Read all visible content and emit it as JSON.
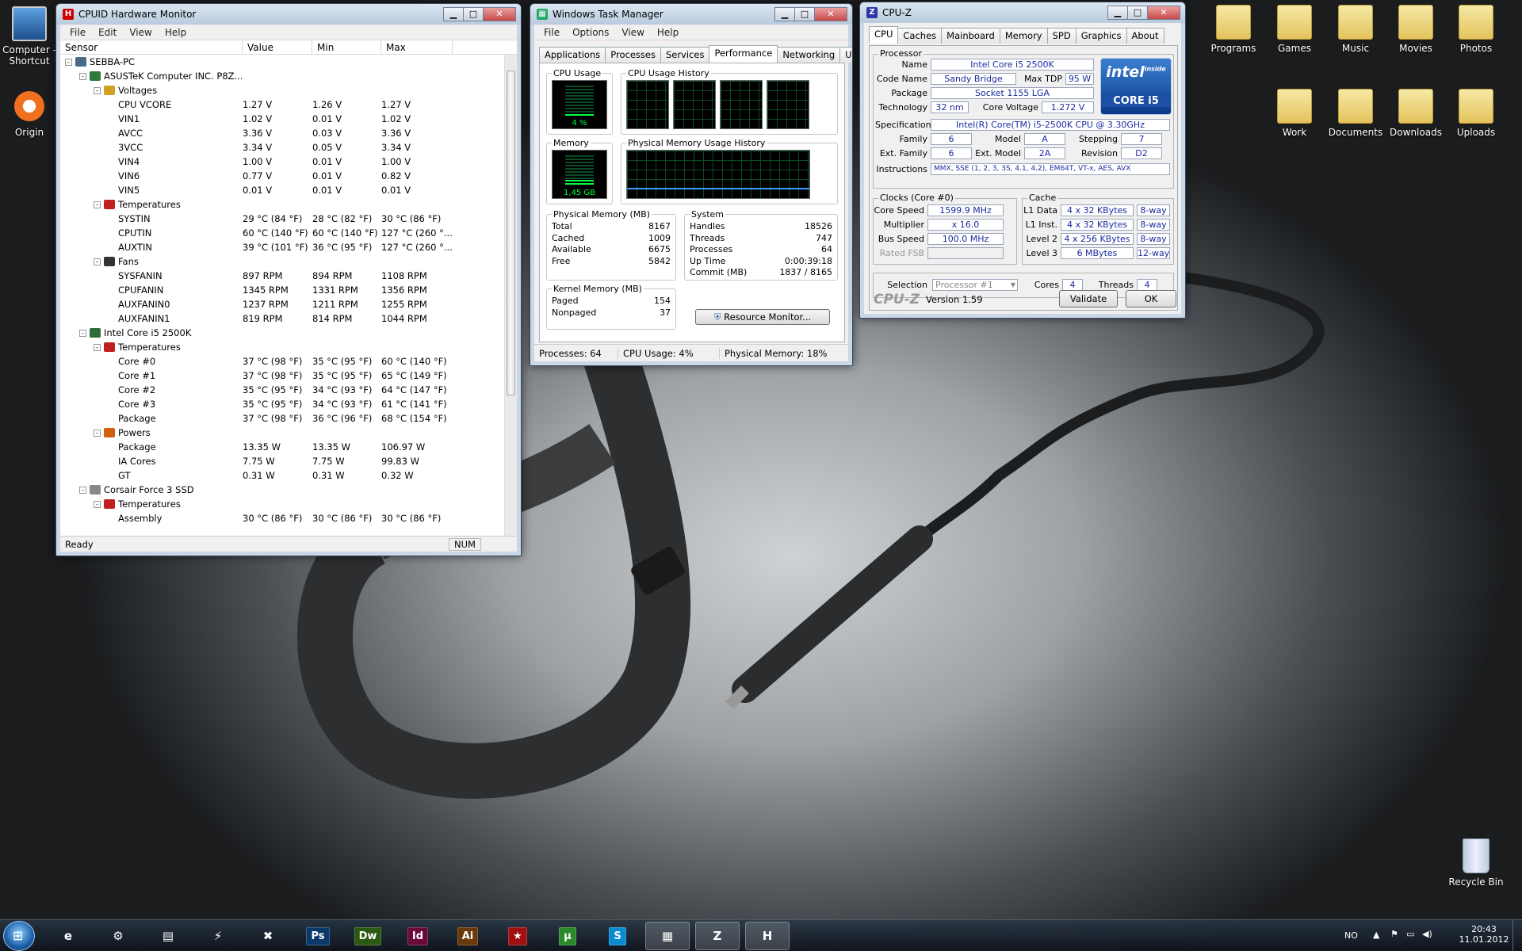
{
  "desktop": {
    "left_icons": [
      {
        "label": "Computer - Shortcut"
      },
      {
        "label": "Origin"
      }
    ],
    "right_icons": [
      {
        "label": "Programs"
      },
      {
        "label": "Games"
      },
      {
        "label": "Music"
      },
      {
        "label": "Movies"
      },
      {
        "label": "Photos"
      },
      {
        "label": "Work"
      },
      {
        "label": "Documents"
      },
      {
        "label": "Downloads"
      },
      {
        "label": "Uploads"
      }
    ],
    "recycle_bin": "Recycle Bin"
  },
  "hwmonitor": {
    "title": "CPUID Hardware Monitor",
    "menu": [
      "File",
      "Edit",
      "View",
      "Help"
    ],
    "columns": [
      "Sensor",
      "Value",
      "Min",
      "Max"
    ],
    "rows": [
      {
        "level": 0,
        "expander": "-",
        "name": "SEBBA-PC",
        "icon": "computer-icon",
        "value": "",
        "min": "",
        "max": ""
      },
      {
        "level": 1,
        "expander": "-",
        "name": "ASUSTeK Computer INC. P8Z...",
        "icon": "motherboard-icon",
        "value": "",
        "min": "",
        "max": ""
      },
      {
        "level": 2,
        "expander": "-",
        "name": "Voltages",
        "icon": "voltage-icon",
        "value": "",
        "min": "",
        "max": ""
      },
      {
        "level": 3,
        "name": "CPU VCORE",
        "value": "1.27 V",
        "min": "1.26 V",
        "max": "1.27 V"
      },
      {
        "level": 3,
        "name": "VIN1",
        "value": "1.02 V",
        "min": "0.01 V",
        "max": "1.02 V"
      },
      {
        "level": 3,
        "name": "AVCC",
        "value": "3.36 V",
        "min": "0.03 V",
        "max": "3.36 V"
      },
      {
        "level": 3,
        "name": "3VCC",
        "value": "3.34 V",
        "min": "0.05 V",
        "max": "3.34 V"
      },
      {
        "level": 3,
        "name": "VIN4",
        "value": "1.00 V",
        "min": "0.01 V",
        "max": "1.00 V"
      },
      {
        "level": 3,
        "name": "VIN6",
        "value": "0.77 V",
        "min": "0.01 V",
        "max": "0.82 V"
      },
      {
        "level": 3,
        "name": "VIN5",
        "value": "0.01 V",
        "min": "0.01 V",
        "max": "0.01 V"
      },
      {
        "level": 2,
        "expander": "-",
        "name": "Temperatures",
        "icon": "thermometer-icon",
        "value": "",
        "min": "",
        "max": ""
      },
      {
        "level": 3,
        "name": "SYSTIN",
        "value": "29 °C  (84 °F)",
        "min": "28 °C  (82 °F)",
        "max": "30 °C  (86 °F)"
      },
      {
        "level": 3,
        "name": "CPUTIN",
        "value": "60 °C  (140 °F)",
        "min": "60 °C  (140 °F)",
        "max": "127 °C  (260 °..."
      },
      {
        "level": 3,
        "name": "AUXTIN",
        "value": "39 °C  (101 °F)",
        "min": "36 °C  (95 °F)",
        "max": "127 °C  (260 °..."
      },
      {
        "level": 2,
        "expander": "-",
        "name": "Fans",
        "icon": "fan-icon",
        "value": "",
        "min": "",
        "max": ""
      },
      {
        "level": 3,
        "name": "SYSFANIN",
        "value": "897 RPM",
        "min": "894 RPM",
        "max": "1108 RPM"
      },
      {
        "level": 3,
        "name": "CPUFANIN",
        "value": "1345 RPM",
        "min": "1331 RPM",
        "max": "1356 RPM"
      },
      {
        "level": 3,
        "name": "AUXFANIN0",
        "value": "1237 RPM",
        "min": "1211 RPM",
        "max": "1255 RPM"
      },
      {
        "level": 3,
        "name": "AUXFANIN1",
        "value": "819 RPM",
        "min": "814 RPM",
        "max": "1044 RPM"
      },
      {
        "level": 1,
        "expander": "-",
        "name": "Intel Core i5 2500K",
        "icon": "cpu-icon",
        "value": "",
        "min": "",
        "max": ""
      },
      {
        "level": 2,
        "expander": "-",
        "name": "Temperatures",
        "icon": "thermometer-icon",
        "value": "",
        "min": "",
        "max": ""
      },
      {
        "level": 3,
        "name": "Core #0",
        "value": "37 °C  (98 °F)",
        "min": "35 °C  (95 °F)",
        "max": "60 °C  (140 °F)"
      },
      {
        "level": 3,
        "name": "Core #1",
        "value": "37 °C  (98 °F)",
        "min": "35 °C  (95 °F)",
        "max": "65 °C  (149 °F)"
      },
      {
        "level": 3,
        "name": "Core #2",
        "value": "35 °C  (95 °F)",
        "min": "34 °C  (93 °F)",
        "max": "64 °C  (147 °F)"
      },
      {
        "level": 3,
        "name": "Core #3",
        "value": "35 °C  (95 °F)",
        "min": "34 °C  (93 °F)",
        "max": "61 °C  (141 °F)"
      },
      {
        "level": 3,
        "name": "Package",
        "value": "37 °C  (98 °F)",
        "min": "36 °C  (96 °F)",
        "max": "68 °C  (154 °F)"
      },
      {
        "level": 2,
        "expander": "-",
        "name": "Powers",
        "icon": "power-icon",
        "value": "",
        "min": "",
        "max": ""
      },
      {
        "level": 3,
        "name": "Package",
        "value": "13.35 W",
        "min": "13.35 W",
        "max": "106.97 W"
      },
      {
        "level": 3,
        "name": "IA Cores",
        "value": "7.75 W",
        "min": "7.75 W",
        "max": "99.83 W"
      },
      {
        "level": 3,
        "name": "GT",
        "value": "0.31 W",
        "min": "0.31 W",
        "max": "0.32 W"
      },
      {
        "level": 1,
        "expander": "-",
        "name": "Corsair Force 3 SSD",
        "icon": "drive-icon",
        "value": "",
        "min": "",
        "max": ""
      },
      {
        "level": 2,
        "expander": "-",
        "name": "Temperatures",
        "icon": "thermometer-icon",
        "value": "",
        "min": "",
        "max": ""
      },
      {
        "level": 3,
        "name": "Assembly",
        "value": "30 °C  (86 °F)",
        "min": "30 °C  (86 °F)",
        "max": "30 °C  (86 °F)"
      }
    ],
    "status": {
      "text": "Ready",
      "num": "NUM"
    }
  },
  "taskmgr": {
    "title": "Windows Task Manager",
    "menu": [
      "File",
      "Options",
      "View",
      "Help"
    ],
    "tabs": [
      "Applications",
      "Processes",
      "Services",
      "Performance",
      "Networking",
      "Users"
    ],
    "active_tab": "Performance",
    "cpu_usage_label": "CPU Usage",
    "cpu_usage_value": "4 %",
    "cpu_usage_fraction": 0.04,
    "cpu_history_label": "CPU Usage History",
    "memory_label": "Memory",
    "memory_value": "1,45 GB",
    "memory_fraction": 0.18,
    "memory_history_label": "Physical Memory Usage History",
    "physical_memory": {
      "title": "Physical Memory (MB)",
      "items": [
        {
          "k": "Total",
          "v": "8167"
        },
        {
          "k": "Cached",
          "v": "1009"
        },
        {
          "k": "Available",
          "v": "6675"
        },
        {
          "k": "Free",
          "v": "5842"
        }
      ]
    },
    "kernel_memory": {
      "title": "Kernel Memory (MB)",
      "items": [
        {
          "k": "Paged",
          "v": "154"
        },
        {
          "k": "Nonpaged",
          "v": "37"
        }
      ]
    },
    "system": {
      "title": "System",
      "items": [
        {
          "k": "Handles",
          "v": "18526"
        },
        {
          "k": "Threads",
          "v": "747"
        },
        {
          "k": "Processes",
          "v": "64"
        },
        {
          "k": "Up Time",
          "v": "0:00:39:18"
        },
        {
          "k": "Commit (MB)",
          "v": "1837 / 8165"
        }
      ]
    },
    "resource_monitor": "Resource Monitor...",
    "status": {
      "processes": "Processes: 64",
      "cpu": "CPU Usage: 4%",
      "memory": "Physical Memory: 18%"
    }
  },
  "cpuz": {
    "title": "CPU-Z",
    "tabs": [
      "CPU",
      "Caches",
      "Mainboard",
      "Memory",
      "SPD",
      "Graphics",
      "About"
    ],
    "active_tab": "CPU",
    "processor_group": "Processor",
    "name_label": "Name",
    "name": "Intel Core i5 2500K",
    "codename_label": "Code Name",
    "codename": "Sandy Bridge",
    "tdp_label": "Max TDP",
    "tdp": "95 W",
    "package_label": "Package",
    "package": "Socket 1155 LGA",
    "technology_label": "Technology",
    "technology": "32 nm",
    "voltage_label": "Core Voltage",
    "voltage": "1.272 V",
    "spec_label": "Specification",
    "spec": "Intel(R) Core(TM) i5-2500K CPU @ 3.30GHz",
    "family_label": "Family",
    "family": "6",
    "model_label": "Model",
    "model": "A",
    "stepping_label": "Stepping",
    "stepping": "7",
    "extfamily_label": "Ext. Family",
    "extfamily": "6",
    "extmodel_label": "Ext. Model",
    "extmodel": "2A",
    "revision_label": "Revision",
    "revision": "D2",
    "instructions_label": "Instructions",
    "instructions": "MMX, SSE (1, 2, 3, 3S, 4.1, 4.2), EM64T, VT-x, AES, AVX",
    "logo": {
      "brand": "intel",
      "inside": "inside",
      "line": "CORE i5"
    },
    "clocks_group": "Clocks (Core #0)",
    "corespeed_label": "Core Speed",
    "corespeed": "1599.9 MHz",
    "multiplier_label": "Multiplier",
    "multiplier": "x 16.0",
    "busspeed_label": "Bus Speed",
    "busspeed": "100.0 MHz",
    "ratedfsb_label": "Rated FSB",
    "ratedfsb": "",
    "cache_group": "Cache",
    "cache": [
      {
        "label": "L1 Data",
        "size": "4 x 32 KBytes",
        "way": "8-way"
      },
      {
        "label": "L1 Inst.",
        "size": "4 x 32 KBytes",
        "way": "8-way"
      },
      {
        "label": "Level 2",
        "size": "4 x 256 KBytes",
        "way": "8-way"
      },
      {
        "label": "Level 3",
        "size": "6 MBytes",
        "way": "12-way"
      }
    ],
    "selection_label": "Selection",
    "selection": "Processor #1",
    "cores_label": "Cores",
    "cores": "4",
    "threads_label": "Threads",
    "threads": "4",
    "brand": "CPU-Z",
    "version": "Version 1.59",
    "validate": "Validate",
    "ok": "OK"
  },
  "taskbar": {
    "apps": [
      {
        "name": "internet-explorer",
        "glyph": "e"
      },
      {
        "name": "network-app",
        "glyph": "⚙"
      },
      {
        "name": "file-explorer",
        "glyph": "▤"
      },
      {
        "name": "winamp",
        "glyph": "⚡"
      },
      {
        "name": "chip-app",
        "glyph": "✖"
      },
      {
        "name": "photoshop",
        "glyph": "Ps"
      },
      {
        "name": "dreamweaver",
        "glyph": "Dw"
      },
      {
        "name": "indesign",
        "glyph": "Id"
      },
      {
        "name": "illustrator",
        "glyph": "Ai"
      },
      {
        "name": "pokerstars",
        "glyph": "★"
      },
      {
        "name": "utorrent",
        "glyph": "µ"
      },
      {
        "name": "skype",
        "glyph": "S"
      },
      {
        "name": "task-manager",
        "glyph": "▦"
      },
      {
        "name": "cpu-z",
        "glyph": "Z"
      },
      {
        "name": "hwmonitor",
        "glyph": "H"
      }
    ],
    "lang": "NO",
    "time": "20:43",
    "date": "11.01.2012"
  },
  "colors": {
    "graph_green": "#00ff40",
    "graph_grid": "#0a4a24",
    "cpuz_value": "#1a2aa0"
  }
}
